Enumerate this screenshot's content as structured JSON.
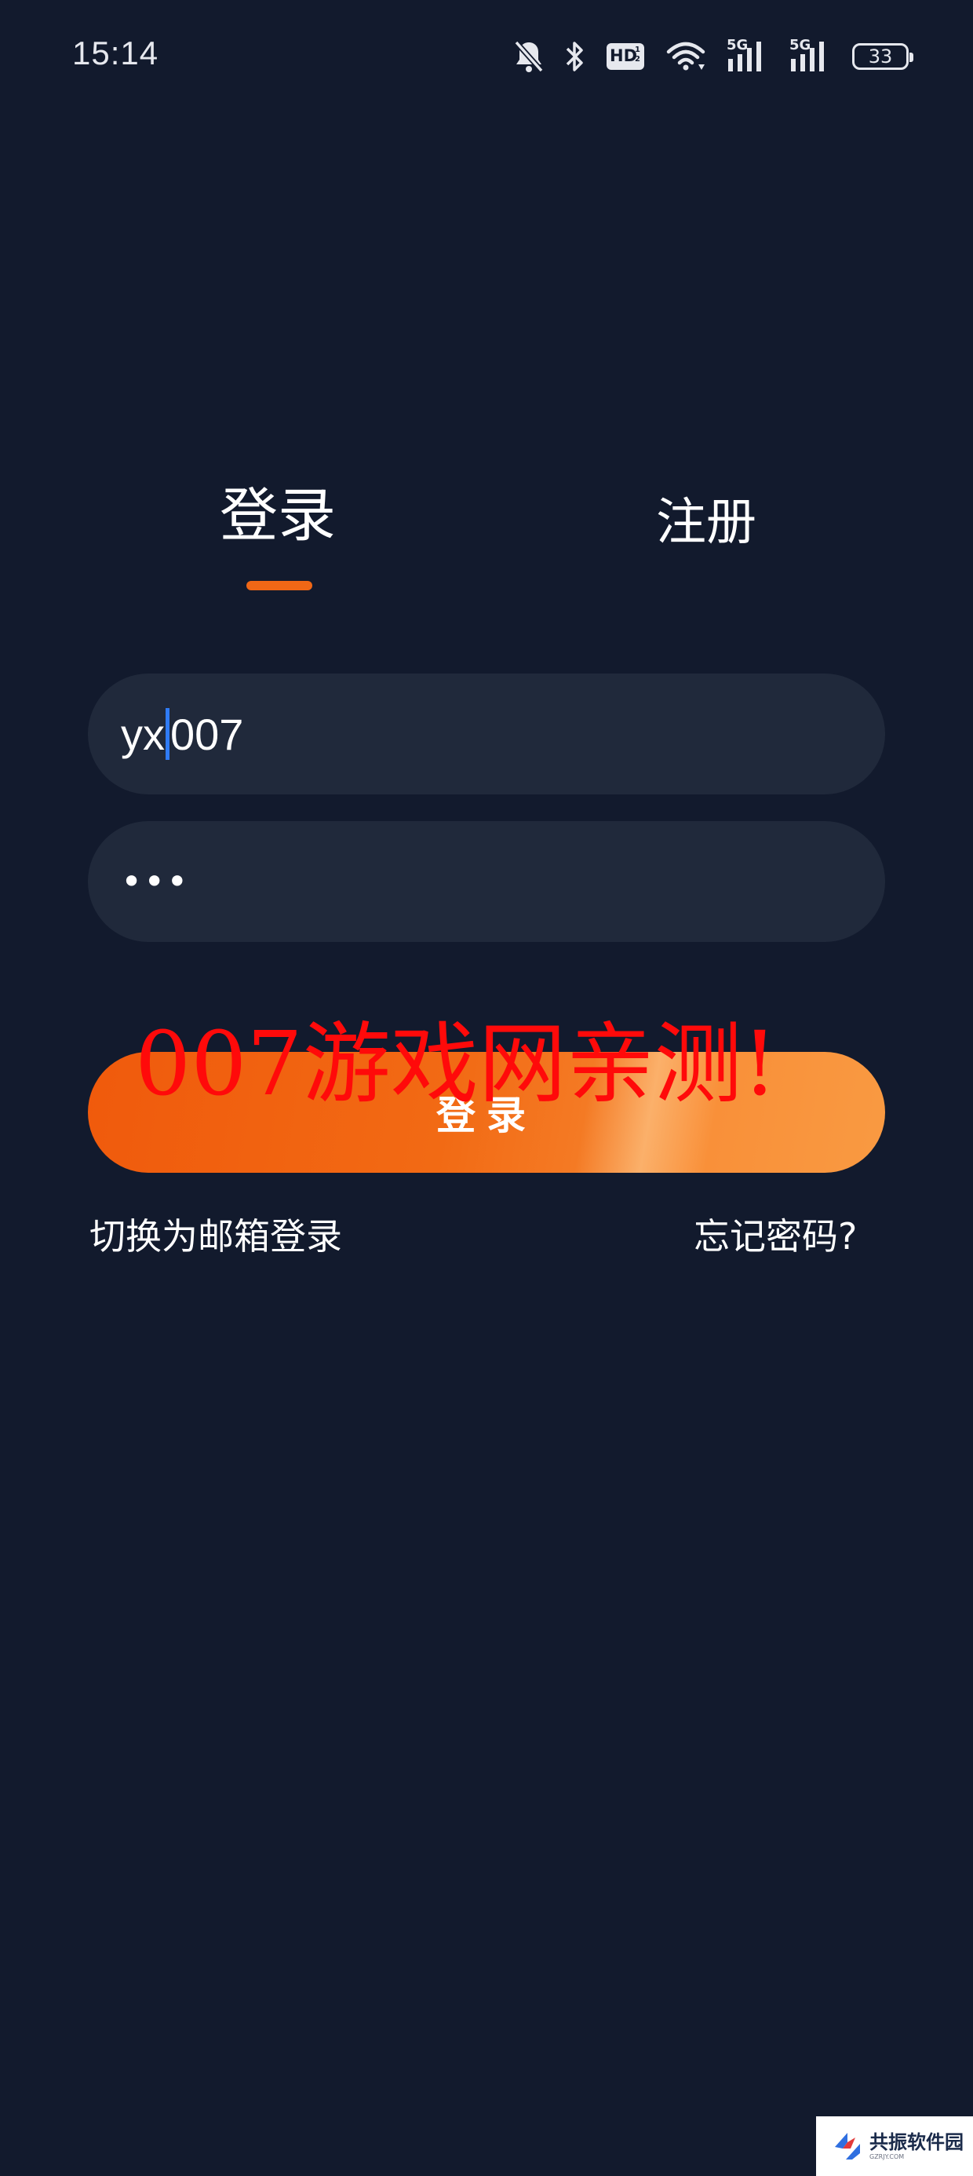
{
  "status_bar": {
    "time": "15:14",
    "icons": [
      "bell-muted-icon",
      "bluetooth-icon",
      "hd-voice-icon",
      "wifi-icon",
      "signal-5g-icon",
      "signal-5g-icon",
      "battery-icon"
    ],
    "hd_label": "HD",
    "hd_sub": "1 2",
    "network_label": "5G",
    "battery_level": "33"
  },
  "tabs": {
    "login": "登录",
    "register": "注册",
    "active": "login",
    "indicator_color": "#f06716"
  },
  "form": {
    "username_before_caret": "yx",
    "username_after_caret": "007",
    "password_masked": "•••"
  },
  "login_button": {
    "label": "登录",
    "gradient": [
      "#f05a0c",
      "#f99a42"
    ]
  },
  "links": {
    "switch_email": "切换为邮箱登录",
    "forgot_password": "忘记密码?"
  },
  "watermark": {
    "text": "007游戏网亲测!",
    "color": "#ff0a0a"
  },
  "corner_logo": {
    "name": "共振软件园",
    "sub": "GZRJY.COM"
  },
  "colors": {
    "background": "#121a2d",
    "input_background": "#20293b",
    "caret": "#2f7bf6"
  }
}
